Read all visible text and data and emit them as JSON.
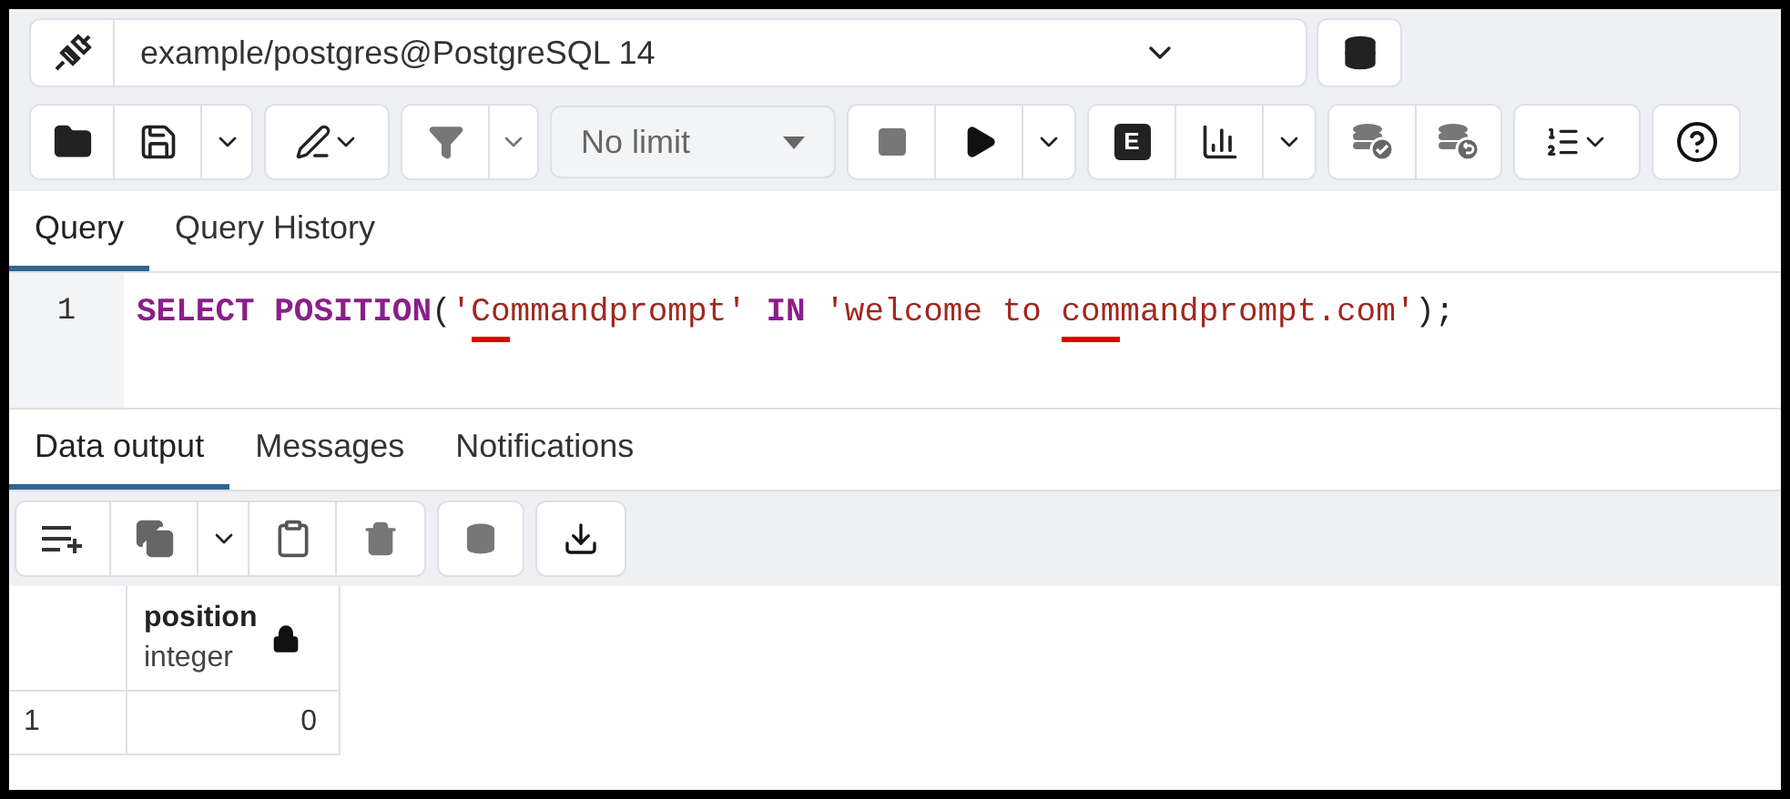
{
  "connection": {
    "value": "example/postgres@PostgreSQL 14"
  },
  "toolbar": {
    "limit": "No limit",
    "explain_label": "E"
  },
  "editor_tabs": [
    {
      "label": "Query",
      "selected": true
    },
    {
      "label": "Query History",
      "selected": false
    }
  ],
  "editor": {
    "lines": [
      {
        "number": "1",
        "tokens": [
          {
            "kind": "keyword",
            "text": "SELECT POSITION"
          },
          {
            "kind": "punct",
            "text": "("
          },
          {
            "kind": "string",
            "text": "'"
          },
          {
            "kind": "string",
            "text": "Co",
            "marked": true
          },
          {
            "kind": "string",
            "text": "mmandprompt'"
          },
          {
            "kind": "keyword",
            "text": " IN "
          },
          {
            "kind": "string",
            "text": "'welcome to "
          },
          {
            "kind": "string",
            "text": "com",
            "marked": true
          },
          {
            "kind": "string",
            "text": "mandprompt.com'"
          },
          {
            "kind": "punct",
            "text": ");"
          }
        ]
      }
    ]
  },
  "output_tabs": [
    {
      "label": "Data output",
      "selected": true
    },
    {
      "label": "Messages",
      "selected": false
    },
    {
      "label": "Notifications",
      "selected": false
    }
  ],
  "table": {
    "columns": [
      {
        "name": "position",
        "type": "integer"
      }
    ],
    "rows": [
      {
        "number": "1",
        "cells": [
          "0"
        ]
      }
    ]
  }
}
